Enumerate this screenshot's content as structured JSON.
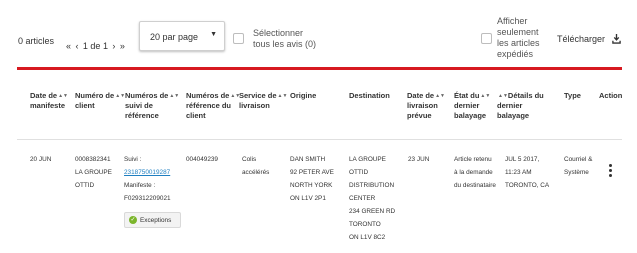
{
  "toolbar": {
    "article_count": "0 articles",
    "pager": {
      "first": "«",
      "prev": "‹",
      "page_text": "1 de 1",
      "next": "›",
      "last": "»"
    },
    "per_page": "20 par page",
    "select_all_line1": "Sélectionner",
    "select_all_line2": "tous les avis (0)",
    "show_line1": "Afficher",
    "show_line2": "seulement",
    "show_line3": "les articles",
    "show_line4": "expédiés",
    "download_label": "Télécharger"
  },
  "colors": {
    "accent_bar": "#d71920",
    "link": "#1f7fc1",
    "success": "#7bb52b"
  },
  "table": {
    "headers": {
      "manifest_date": [
        "Date de",
        "manifeste"
      ],
      "client_number": [
        "Numéro de",
        "client"
      ],
      "tracking": [
        "Numéros de",
        "suivi de",
        "référence"
      ],
      "client_ref": [
        "Numéros de",
        "référence du",
        "client"
      ],
      "service": [
        "Service de",
        "livraison"
      ],
      "origin": [
        "Origine"
      ],
      "destination": [
        "Destination"
      ],
      "expected_date": [
        "Date de",
        "livraison",
        "prévue"
      ],
      "last_scan_state": [
        "État du",
        "dernier",
        "balayage"
      ],
      "last_scan_details": [
        "Détails du",
        "dernier",
        "balayage"
      ],
      "type": [
        "Type"
      ],
      "action": [
        "Action"
      ]
    },
    "row": {
      "manifest_date": "20 JUN",
      "client_number": [
        "0008382341",
        "LA GROUPE",
        "OTTID"
      ],
      "tracking_label": "Suivi :",
      "tracking_number": "2318750019287",
      "manifest_label": "Manifeste :",
      "manifest_number": "F029312209021",
      "exceptions_badge": "Exceptions",
      "client_ref": "004049239",
      "service": [
        "Colis",
        "accélérés"
      ],
      "origin": [
        "DAN SMITH",
        "92 PETER AVE",
        "NORTH YORK",
        "ON L1V 2P1"
      ],
      "destination": [
        "LA GROUPE",
        "OTTID",
        "DISTRIBUTION",
        "CENTER",
        "234 GREEN RD",
        "TORONTO",
        "ON L1V 8C2"
      ],
      "expected_date": "23 JUN",
      "last_scan_state": [
        "Article retenu",
        "à la demande",
        "du destinataire"
      ],
      "last_scan_details": [
        "JUL 5 2017,",
        "11:23 AM",
        "TORONTO, CA"
      ],
      "type": [
        "Courriel &",
        "Système"
      ]
    }
  }
}
